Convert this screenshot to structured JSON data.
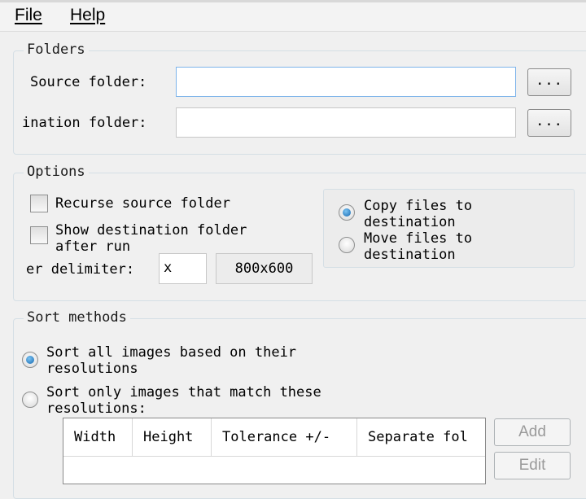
{
  "menu": {
    "file": "File",
    "help": "Help"
  },
  "folders": {
    "title": "Folders",
    "source_label": "Source folder:",
    "source_value": "",
    "destination_label": "ination folder:",
    "destination_value": "",
    "browse_label": "..."
  },
  "options": {
    "title": "Options",
    "recurse_label": "Recurse source folder",
    "show_dest_label_line1": "Show destination folder",
    "show_dest_label_line2": "after run",
    "delimiter_label": "er delimiter:",
    "delimiter_value": "x",
    "preview_value": "800x600",
    "copy_line1": "Copy files to",
    "copy_line2": "destination",
    "move_line1": "Move files to",
    "move_line2": "destination",
    "selected_mode": "copy"
  },
  "sort": {
    "title": "Sort methods",
    "all_line1": "Sort all images based on their",
    "all_line2": "resolutions",
    "match_line1": "Sort only images that match these",
    "match_line2": "resolutions:",
    "selected_method": "all",
    "columns": [
      "Width",
      "Height",
      "Tolerance +/-",
      "Separate fol"
    ],
    "add_label": "Add",
    "edit_label": "Edit"
  }
}
